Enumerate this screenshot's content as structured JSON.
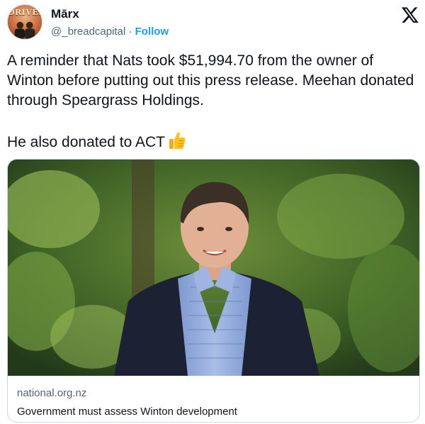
{
  "post": {
    "author": {
      "display_name": "Mārx",
      "handle": "@_breadcapital",
      "separator": "·",
      "follow_label": "Follow",
      "avatar_text": "DRIVERS"
    },
    "platform_icon": "x-logo-icon",
    "text_paragraph_1": "A reminder that Nats took $51,994.70 from the owner of Winton before putting out this press release. Meehan donated through Speargrass Holdings.",
    "text_paragraph_2": "He also donated to ACT",
    "emoji": "thumbs-up-icon"
  },
  "link_card": {
    "image": "portrait-photo",
    "domain": "national.org.nz",
    "title": "Government must assess Winton development"
  },
  "colors": {
    "link_blue": "#1d9bf0",
    "secondary_text": "#536471",
    "border": "#cfd9de"
  }
}
